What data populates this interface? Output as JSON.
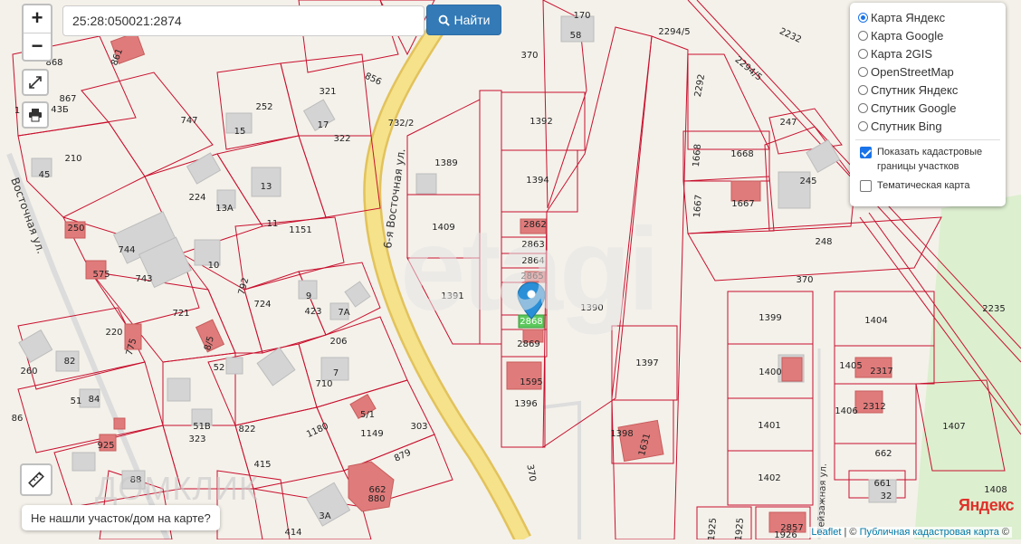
{
  "search": {
    "value": "25:28:050021:2874",
    "button_label": "Найти"
  },
  "zoom": {
    "in_label": "+",
    "out_label": "−"
  },
  "layers": {
    "base_options": [
      {
        "label": "Карта Яндекс",
        "selected": true
      },
      {
        "label": "Карта Google",
        "selected": false
      },
      {
        "label": "Карта 2GIS",
        "selected": false
      },
      {
        "label": "OpenStreetMap",
        "selected": false
      },
      {
        "label": "Спутник Яндекс",
        "selected": false
      },
      {
        "label": "Спутник Google",
        "selected": false
      },
      {
        "label": "Спутник Bing",
        "selected": false
      }
    ],
    "overlays": [
      {
        "label": "Показать кадастровые границы участков",
        "checked": true
      },
      {
        "label": "Тематическая карта",
        "checked": false
      }
    ]
  },
  "not_found_label": "Не нашли участок/дом на карте?",
  "attribution": {
    "leaflet": "Leaflet",
    "separator": "| ©",
    "cadastre": "Публичная кадастровая карта",
    "suffix": "©"
  },
  "yandex_logo": "Яндекс",
  "watermarks": {
    "domklik": "ДОМКЛИК",
    "etagi": "etagi"
  },
  "map": {
    "streets": [
      "6-я Восточная ул.",
      "Восточная ул.",
      "Пейзажная ул."
    ],
    "selected_parcel": "2868",
    "parcel_labels": [
      "170",
      "58",
      "2294/5",
      "2232",
      "370",
      "2292",
      "2294/5",
      "247",
      "1392",
      "1668",
      "1668",
      "245",
      "1394",
      "1389",
      "1667",
      "1667",
      "2862",
      "1409",
      "2863",
      "248",
      "2864",
      "2865",
      "1391",
      "1390",
      "370",
      "1399",
      "1404",
      "2235",
      "2869",
      "1400",
      "1405",
      "2317",
      "1397",
      "1595",
      "1396",
      "1401",
      "1406",
      "2312",
      "1407",
      "1398",
      "1631",
      "662",
      "1402",
      "661",
      "1408",
      "32",
      "370",
      "1925",
      "1925",
      "2857",
      "1926",
      "321",
      "856",
      "252",
      "747",
      "15",
      "17",
      "322",
      "867",
      "43Б",
      "732/2",
      "45",
      "210",
      "224",
      "13",
      "13А",
      "250",
      "11",
      "1151",
      "744",
      "575",
      "10",
      "743",
      "792",
      "724",
      "9",
      "423",
      "7А",
      "721",
      "220",
      "775",
      "8/5",
      "206",
      "260",
      "82",
      "52",
      "7",
      "710",
      "51",
      "84",
      "86",
      "51В",
      "822",
      "5/1",
      "1180",
      "1149",
      "303",
      "925",
      "323",
      "879",
      "415",
      "662",
      "880",
      "88",
      "3А",
      "414",
      "861",
      "868",
      "1"
    ],
    "overlay_legend": []
  },
  "colors": {
    "parcel_border": "#c8102e",
    "building": "#e07b7b",
    "house_gray": "#d4d4d4",
    "road_fill": "#f5e28a",
    "road_edge": "#e2c25c",
    "green": "#dcefcf",
    "marker": "#2a8fd7",
    "selected_parcel": "#5cc85c",
    "button": "#337ab7"
  }
}
